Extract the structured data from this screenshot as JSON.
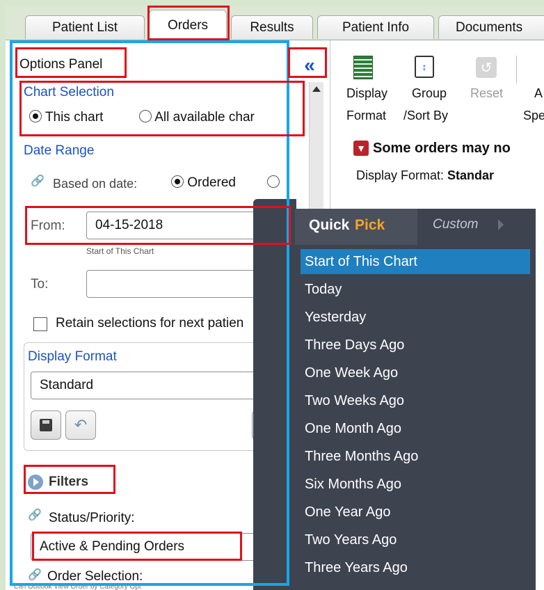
{
  "tabs": [
    "Patient List",
    "Orders",
    "Results",
    "Patient Info",
    "Documents"
  ],
  "options_panel": {
    "title": "Options Panel",
    "chart_selection": {
      "heading": "Chart Selection",
      "this_chart": "This chart",
      "all_charts": "All available char"
    },
    "date_range": {
      "heading": "Date Range",
      "based_on": "Based on date:",
      "ordered": "Ordered",
      "from_label": "From:",
      "from_value": "04-15-2018",
      "from_hint": "Start of This Chart",
      "to_label": "To:",
      "to_value": ""
    },
    "retain": "Retain selections for next patien",
    "display_format": {
      "heading": "Display Format",
      "value": "Standard"
    },
    "filters": {
      "heading": "Filters",
      "status_label": "Status/Priority:",
      "status_value": "Active & Pending Orders",
      "order_selection": "Order Selection:"
    }
  },
  "toolbar": {
    "display_format": [
      "Display",
      "Format"
    ],
    "group_sort": [
      "Group",
      "/Sort By"
    ],
    "reset": "Reset",
    "spe": "Spe",
    "a_char": "A",
    "warning": "Some orders may no",
    "display_format_prefix": "Display Format: ",
    "display_format_value": "Standar"
  },
  "quickpick": {
    "tab_quick": "Quick",
    "tab_pick": "Pick",
    "tab_custom": "Custom",
    "items": [
      "Start of This Chart",
      "Today",
      "Yesterday",
      "Three Days Ago",
      "One Week Ago",
      "Two Weeks Ago",
      "One Month Ago",
      "Three Months Ago",
      "Six Months Ago",
      "One Year Ago",
      "Two Years Ago",
      "Three Years Ago"
    ]
  },
  "bottom_text": "Clin Outlook View Order by Category Opt",
  "colors": {
    "highlight_red": "#e0101a",
    "panel_blue": "#17a6ea",
    "link_blue": "#1a52c9",
    "quickpick_bg": "#3e4350",
    "quickpick_selected": "#1f7fbf",
    "pick_orange": "#f5a623"
  }
}
